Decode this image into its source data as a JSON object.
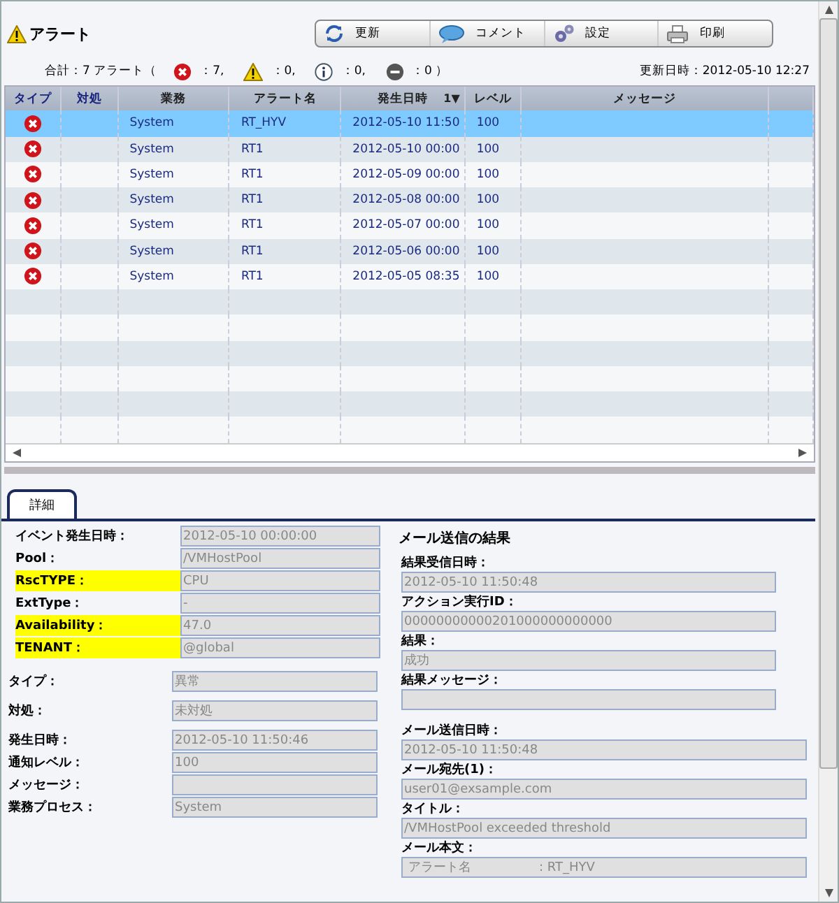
{
  "header": {
    "title": "アラート"
  },
  "toolbar": [
    {
      "kind": "refresh",
      "label": "更新"
    },
    {
      "kind": "comment",
      "label": "コメント"
    },
    {
      "kind": "settings",
      "label": "設定"
    },
    {
      "kind": "print",
      "label": "印刷"
    }
  ],
  "summary": {
    "total": "合計：7 アラート（",
    "counts": [
      {
        "kind": "error",
        "text": "：7,"
      },
      {
        "kind": "warning",
        "text": "：0,"
      },
      {
        "kind": "info",
        "text": "：0,"
      },
      {
        "kind": "stop",
        "text": "：0 ）"
      }
    ],
    "updated": "更新日時：2012-05-10 12:27"
  },
  "table": {
    "columns": [
      {
        "label": "タイプ"
      },
      {
        "label": "対処"
      },
      {
        "label": "業務"
      },
      {
        "label": "アラート名"
      },
      {
        "label": "発生日時",
        "sort": "1▼"
      },
      {
        "label": "レベル"
      },
      {
        "label": "メッセージ"
      }
    ],
    "rows": [
      {
        "kind": "error",
        "selected": true,
        "cells": [
          "",
          "",
          "System",
          "RT_HYV",
          "2012-05-10 11:50",
          "100"
        ]
      },
      {
        "kind": "error",
        "selected": false,
        "cells": [
          "",
          "",
          "System",
          "RT1",
          "2012-05-10 00:00",
          "100"
        ]
      },
      {
        "kind": "error",
        "selected": false,
        "cells": [
          "",
          "",
          "System",
          "RT1",
          "2012-05-09 00:00",
          "100"
        ]
      },
      {
        "kind": "error",
        "selected": false,
        "cells": [
          "",
          "",
          "System",
          "RT1",
          "2012-05-08 00:00",
          "100"
        ]
      },
      {
        "kind": "error",
        "selected": false,
        "cells": [
          "",
          "",
          "System",
          "RT1",
          "2012-05-07 00:00",
          "100"
        ]
      },
      {
        "kind": "error",
        "selected": false,
        "cells": [
          "",
          "",
          "System",
          "RT1",
          "2012-05-06 00:00",
          "100"
        ]
      },
      {
        "kind": "error",
        "selected": false,
        "cells": [
          "",
          "",
          "System",
          "RT1",
          "2012-05-05 08:35",
          "100"
        ]
      }
    ]
  },
  "tabs": [
    {
      "label": "詳細",
      "selected": true
    }
  ],
  "details": {
    "event_fields": [
      {
        "label": "イベント発生日時：",
        "value": "2012-05-10 00:00:00",
        "highlighted": false
      },
      {
        "label": "Pool：",
        "value": "/VMHostPool",
        "highlighted": false
      },
      {
        "label": "RscTYPE：",
        "value": "CPU",
        "highlighted": true
      },
      {
        "label": "ExtType：",
        "value": "-",
        "highlighted": false
      },
      {
        "label": "Availability：",
        "value": "47.0",
        "highlighted": true
      },
      {
        "label": "TENANT：",
        "value": "@global",
        "highlighted": true
      }
    ],
    "alert_fields": [
      {
        "label": "タイプ：",
        "value": "異常"
      },
      {
        "label": "対処：",
        "value": "未対処"
      },
      {
        "label": "発生日時：",
        "value": "2012-05-10 11:50:46"
      },
      {
        "label": "通知レベル：",
        "value": "100"
      },
      {
        "label": "メッセージ："
      },
      {
        "label": "業務プロセス：",
        "value": "System"
      }
    ]
  },
  "mail_result": {
    "title": "メール送信の結果",
    "result_fields": [
      {
        "label": "結果受信日時：",
        "value": "2012-05-10 11:50:48"
      },
      {
        "label": "アクション実行ID：",
        "value": "00000000000201000000000000"
      },
      {
        "label": "結果：",
        "value": "成功"
      },
      {
        "label": "結果メッセージ："
      }
    ],
    "mail_fields": [
      {
        "label": "メール送信日時：",
        "value": "2012-05-10 11:50:48"
      },
      {
        "label": "メール宛先(1)：",
        "value": "user01@exsample.com"
      },
      {
        "label": "タイトル：",
        "value": "/VMHostPool exceeded threshold"
      },
      {
        "label": "メール本文：",
        "value": " アラート名                 : RT_HYV"
      }
    ]
  }
}
